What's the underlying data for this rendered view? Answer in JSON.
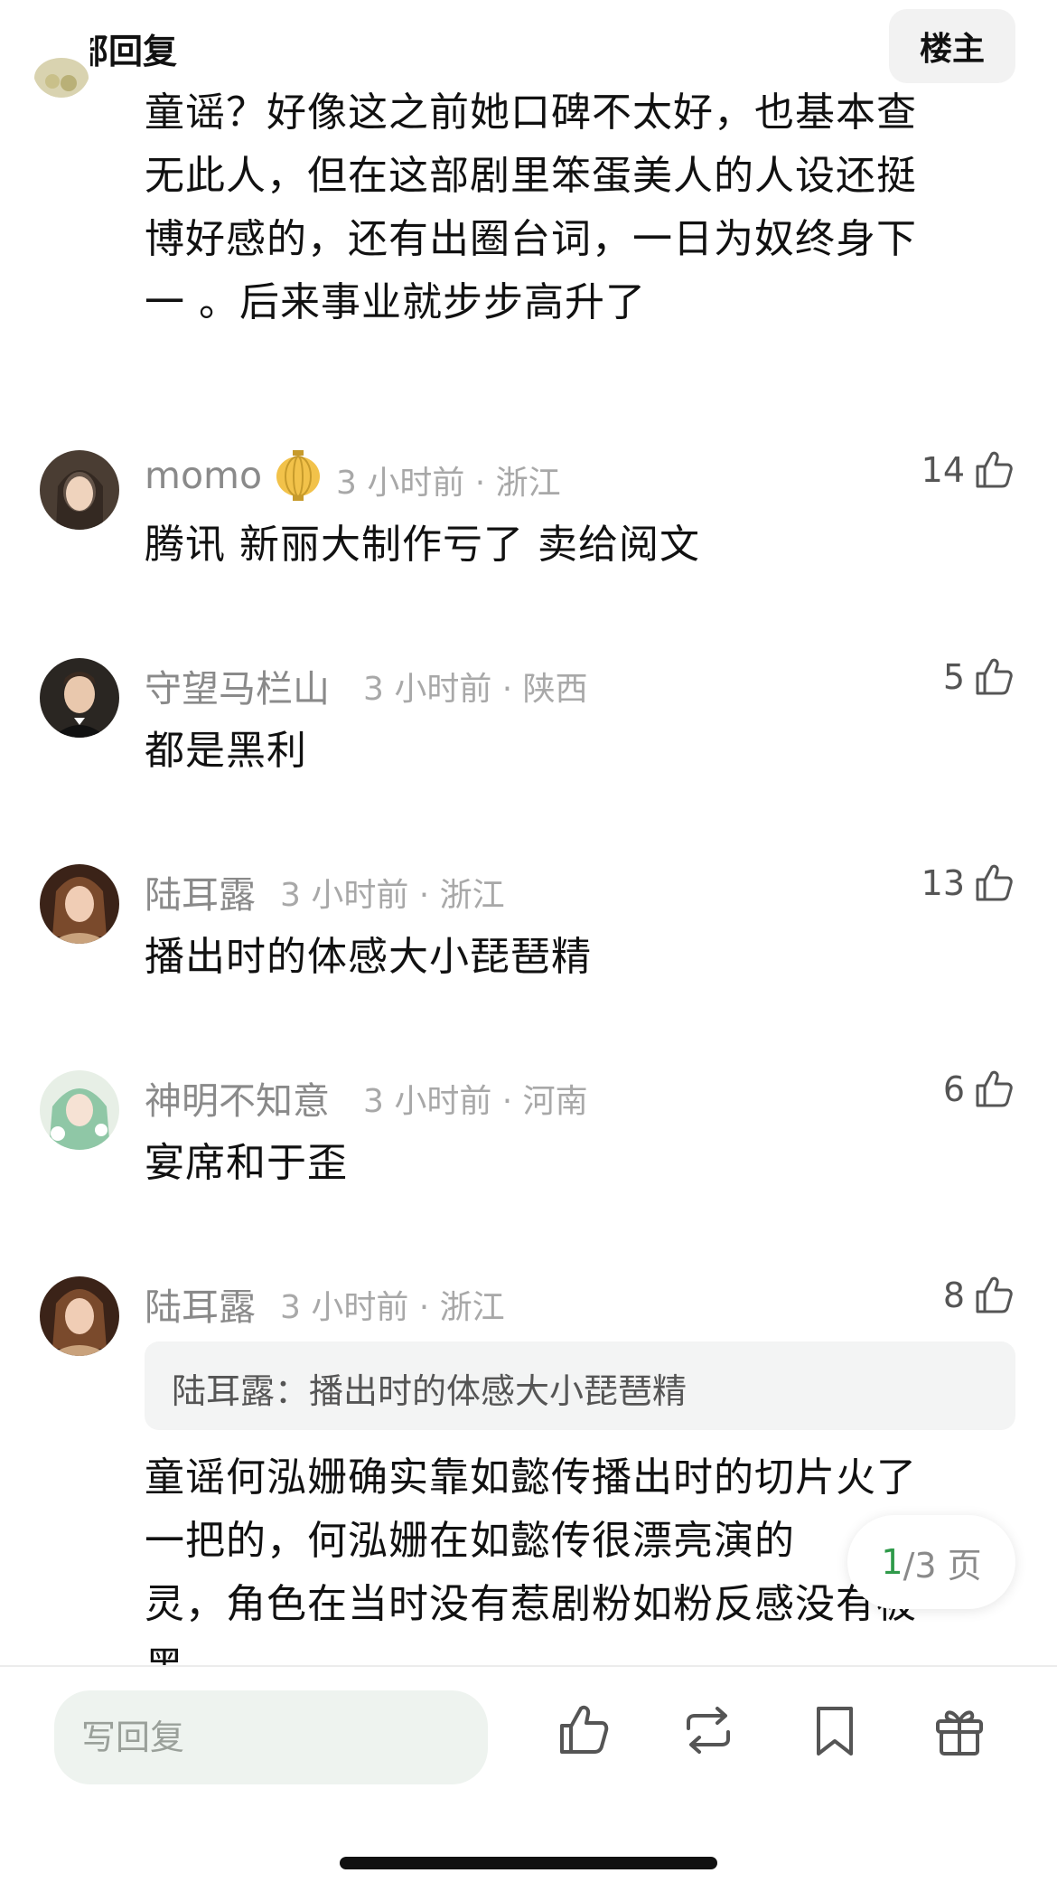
{
  "header": {
    "title": "全部回复",
    "op_button": "楼主"
  },
  "first_comment_text": [
    "童谣？好像这之前她口碑不太好，也基本查",
    "无此人，但在这部剧里笨蛋美人的人设还挺",
    "博好感的，还有出圈台词，一日为奴终身下",
    "一 。后来事业就步步高升了"
  ],
  "comments": [
    {
      "name": "momo",
      "time_location": "3 小时前 · 浙江",
      "likes": "14",
      "text": "腾讯 新丽大制作亏了 卖给阅文",
      "badge": "lantern-badge"
    },
    {
      "name": "守望马栏山",
      "time_location": "3 小时前 · 陕西",
      "likes": "5",
      "text": "都是黑利"
    },
    {
      "name": "陆耳露",
      "time_location": "3 小时前 · 浙江",
      "likes": "13",
      "text": "播出时的体感大小琵琶精"
    },
    {
      "name": "神明不知意",
      "time_location": "3 小时前 · 河南",
      "likes": "6",
      "text": "宴席和于歪"
    },
    {
      "name": "陆耳露",
      "time_location": "3 小时前 · 浙江",
      "likes": "8",
      "quote": "陆耳露：播出时的体感大小琵琶精",
      "text_lines": [
        "童谣何泓姗确实靠如懿传播出时的切片火了",
        "一把的，何泓姗在如懿传很漂亮演的",
        "灵，角色在当时没有惹剧粉如粉反感没有被",
        "黑"
      ]
    }
  ],
  "pager": {
    "current": "1",
    "total_text": "/3 页"
  },
  "bottom_bar": {
    "reply_placeholder": "写回复"
  },
  "colors": {
    "accent_green": "#2f9a4a",
    "meta_gray": "#a8a8a8",
    "name_gray": "#8a8a8a"
  }
}
